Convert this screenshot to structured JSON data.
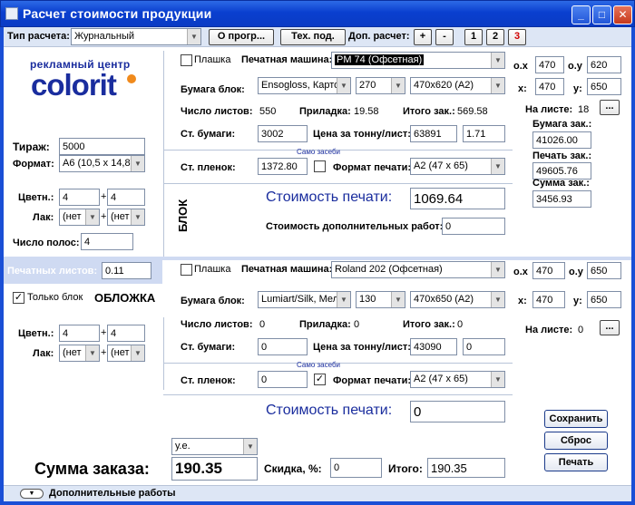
{
  "window": {
    "title": "Расчет стоимости продукции"
  },
  "toolbar": {
    "calc_type_label": "Тип расчета:",
    "calc_type_value": "Журнальный",
    "about_button": "О прогр...",
    "tech_button": "Тех. под.",
    "extra_calc_label": "Доп. расчет:",
    "plus": "+",
    "minus": "-",
    "page1": "1",
    "page2": "2",
    "page3": "3"
  },
  "logo": {
    "top_text": "рекламный центр",
    "brand": "colorit"
  },
  "left": {
    "tirazh_label": "Тираж:",
    "tirazh_value": "5000",
    "format_label": "Формат:",
    "format_value": "А6 (10,5 х 14,8)",
    "colors_label": "Цветн.:",
    "color_a": "4",
    "color_b": "4",
    "plus": "+",
    "lak_label": "Лак:",
    "lak_a": "(нет",
    "lak_b": "(нет",
    "pages_label": "Число полос:",
    "pages_value": "4",
    "sheets_label": "Печатных листов:",
    "sheets_value": "0.11"
  },
  "block": {
    "side_label": "БЛОК",
    "plashka": "Плашка",
    "machine_label": "Печатная машина:",
    "machine_value": "PM 74 (Офсетная)",
    "ox_label": "o.x",
    "ox": "470",
    "oy_label": "o.y",
    "oy": "620",
    "paper_label": "Бумага блок:",
    "paper_value": "Ensogloss, Карто",
    "weight": "270",
    "size": "470x620 (A2)",
    "x_label": "x:",
    "x": "470",
    "y_label": "y:",
    "y": "650",
    "sheets_count_label": "Число листов:",
    "sheets_count": "550",
    "pril_label": "Приладка:",
    "pril": "19.58",
    "total_zak_label": "Итого зак.:",
    "total_zak": "569.58",
    "on_sheet_label": "На листе:",
    "on_sheet": "18",
    "dots": "...",
    "st_paper_label": "Ст. бумаги:",
    "st_paper": "3002",
    "price_ton_label": "Цена за тонну/лист:",
    "price_ton": "63891",
    "price_k": "1.71",
    "paper_zak_label": "Бумага зак.:",
    "paper_zak": "41026.00",
    "own_paper": "Само засеби",
    "st_film_label": "Ст. пленок:",
    "st_film": "1372.80",
    "print_format_label": "Формат печати:",
    "print_format": "A2 (47 x 65)",
    "print_zak_label": "Печать зак.:",
    "print_zak": "49605.76",
    "sum_zak_label": "Сумма зак.:",
    "sum_zak": "3456.93",
    "print_cost_label": "Стоимость печати:",
    "print_cost": "1069.64",
    "extra_work_label": "Стоимость дополнительных работ:",
    "extra_work": "0"
  },
  "cover": {
    "only_block": "Только блок",
    "title": "ОБЛОЖКА",
    "plashka": "Плашка",
    "machine_label": "Печатная машина:",
    "machine_value": "Roland 202 (Офсетная)",
    "ox_label": "o.x",
    "ox": "470",
    "oy_label": "o.y",
    "oy": "650",
    "paper_label": "Бумага блок:",
    "paper_value": "Lumiart/Silk, Мело",
    "weight": "130",
    "size": "470x650 (A2)",
    "x_label": "x:",
    "x": "470",
    "y_label": "y:",
    "y": "650",
    "colors_label": "Цветн.:",
    "color_a": "4",
    "color_b": "4",
    "plus": "+",
    "lak_label": "Лак:",
    "lak_a": "(нет",
    "lak_b": "(нет",
    "sheets_count_label": "Число листов:",
    "sheets_count": "0",
    "pril_label": "Приладка:",
    "pril": "0",
    "total_zak_label": "Итого зак.:",
    "total_zak": "0",
    "on_sheet_label": "На листе:",
    "on_sheet": "0",
    "dots": "...",
    "st_paper_label": "Ст. бумаги:",
    "st_paper": "0",
    "price_ton_label": "Цена за тонну/лист:",
    "price_ton": "43090",
    "price_k": "0",
    "own_paper": "Само засеби",
    "st_film_label": "Ст. пленок:",
    "st_film": "0",
    "check_mark": "✓",
    "print_format_label": "Формат печати:",
    "print_format": "A2 (47 x 65)",
    "print_cost_label": "Стоимость печати:",
    "print_cost": "0"
  },
  "actions": {
    "save": "Сохранить",
    "reset": "Сброс",
    "print": "Печать"
  },
  "totals": {
    "currency": "у.е.",
    "sum_label": "Сумма заказа:",
    "sum": "190.35",
    "discount_label": "Скидка, %:",
    "discount": "0",
    "total_label": "Итого:",
    "total": "190.35"
  },
  "bottom": {
    "extra_works": "Дополнительные работы"
  },
  "colors": {
    "accent": "#1a4fd6",
    "price_text": "#1a2d9e",
    "logo_orange": "#f08a1c"
  }
}
